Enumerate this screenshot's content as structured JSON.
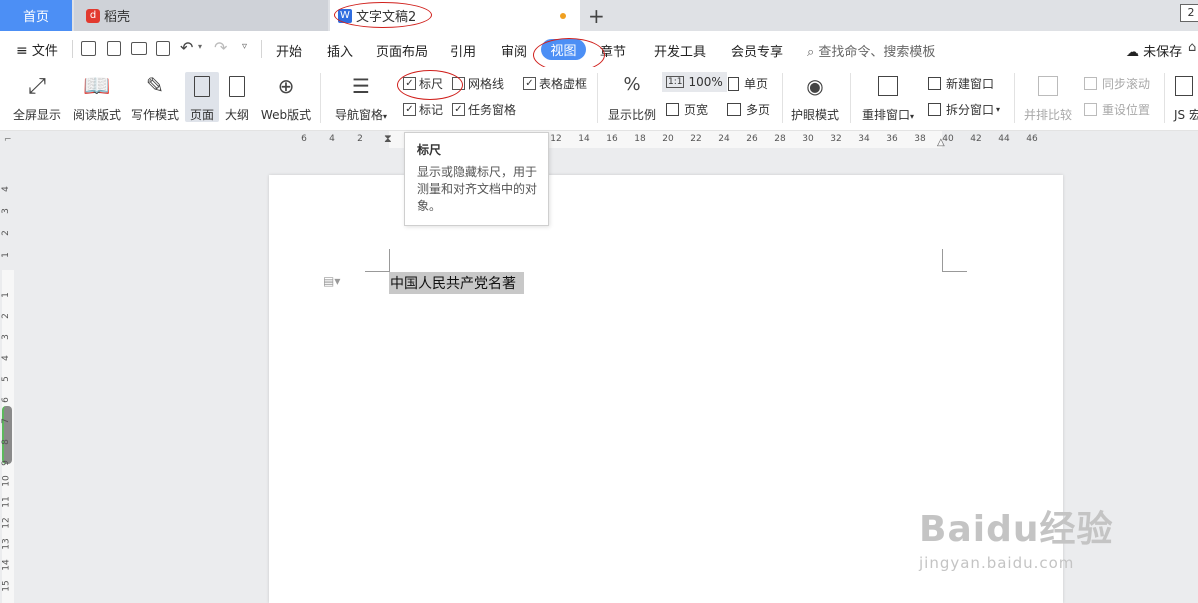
{
  "tabs": {
    "home": "首页",
    "daoke": "稻壳",
    "doc": "文字文稿2",
    "page_count": "2"
  },
  "menu": {
    "file": "文件",
    "items": [
      "开始",
      "插入",
      "页面布局",
      "引用",
      "审阅",
      "视图",
      "章节",
      "开发工具",
      "会员专享"
    ],
    "search": "查找命令、搜索模板",
    "unsaved": "未保存"
  },
  "ribbon": {
    "fullscreen": "全屏显示",
    "read_mode": "阅读版式",
    "write_mode": "写作模式",
    "page": "页面",
    "outline": "大纲",
    "web": "Web版式",
    "nav_pane": "导航窗格",
    "ruler": "标尺",
    "gridlines": "网格线",
    "table_gridlines": "表格虚框",
    "marks": "标记",
    "task_pane": "任务窗格",
    "zoom": "显示比例",
    "zoom_value": "100%",
    "single_page": "单页",
    "page_width": "页宽",
    "multi_page": "多页",
    "eye_mode": "护眼模式",
    "arrange": "重排窗口",
    "new_window": "新建窗口",
    "split_window": "拆分窗口",
    "compare": "并排比较",
    "sync_scroll": "同步滚动",
    "reset_position": "重设位置",
    "js": "JS 宏"
  },
  "ruler": {
    "h_ticks": [
      "6",
      "4",
      "2",
      "2",
      "12",
      "14",
      "16",
      "18",
      "20",
      "22",
      "24",
      "26",
      "28",
      "30",
      "32",
      "34",
      "36",
      "38",
      "40",
      "42",
      "44",
      "46"
    ],
    "v_ticks": [
      "4",
      "3",
      "2",
      "1",
      "1",
      "2",
      "3",
      "4",
      "5",
      "6",
      "7",
      "8",
      "9",
      "10",
      "11",
      "12",
      "13",
      "14",
      "15"
    ]
  },
  "tooltip": {
    "title": "标尺",
    "body": "显示或隐藏标尺，用于测量和对齐文档中的对象。"
  },
  "document": {
    "text": "中国人民共产党名著"
  },
  "watermark": {
    "brand": "Baidu经验",
    "url": "jingyan.baidu.com"
  },
  "colors": {
    "accent": "#4c8ff5",
    "annotation": "#d0201c",
    "tab_bar": "#dfe1e5"
  }
}
